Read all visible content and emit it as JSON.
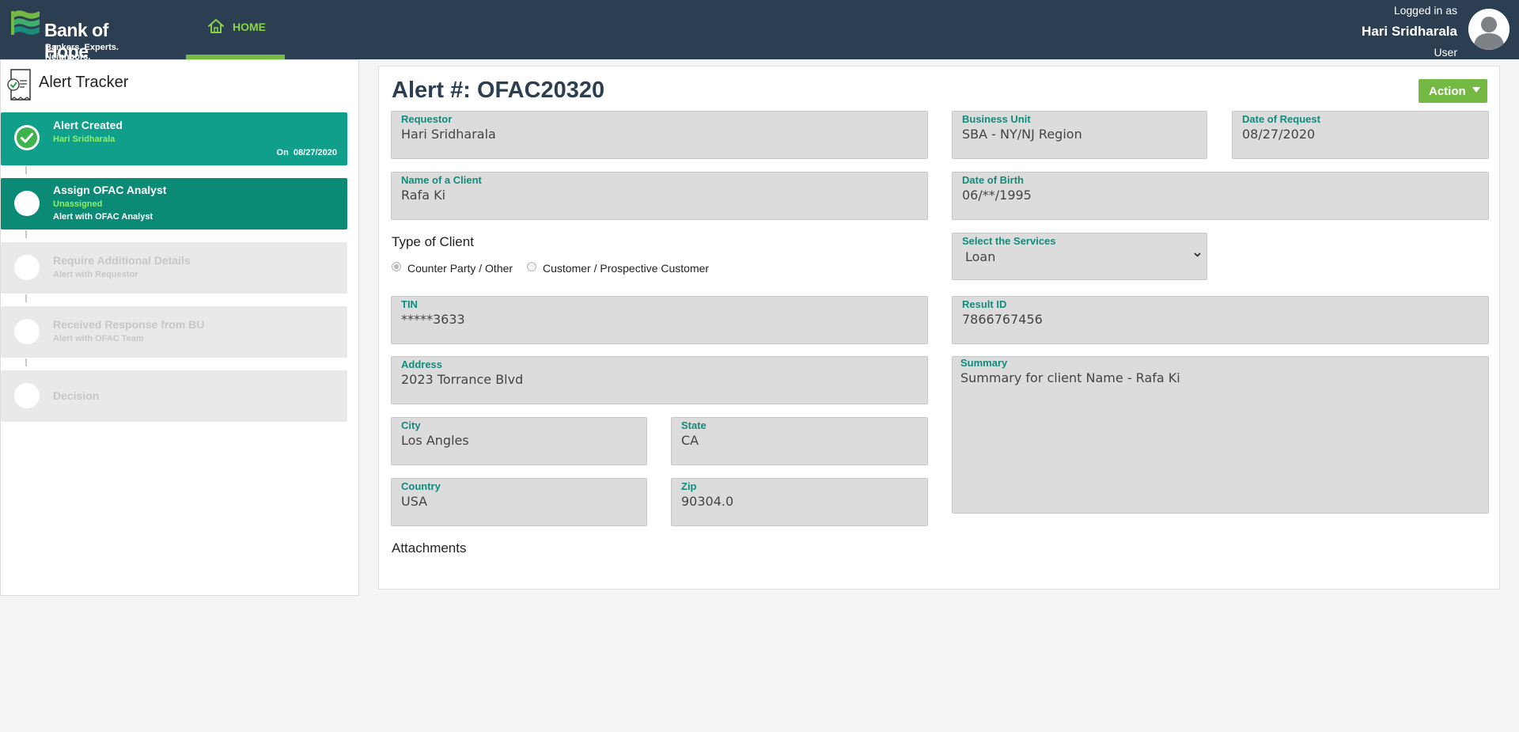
{
  "header": {
    "brand_name": "Bank of Hope",
    "brand_tagline": "Bankers. Experts. Neighbors.",
    "nav_home_label": "HOME",
    "logged_in_label": "Logged in as",
    "user_name": "Hari Sridharala",
    "user_role": "User",
    "colors": {
      "bar": "#2c3e52",
      "accent": "#73b944"
    }
  },
  "tracker": {
    "title": "Alert Tracker",
    "steps": [
      {
        "title": "Alert Created",
        "subtitle": "Hari Sridharala",
        "date_label": "On  08/27/2020",
        "status": "done"
      },
      {
        "title": "Assign OFAC Analyst",
        "subtitle": "Unassigned",
        "note": "Alert with OFAC Analyst",
        "status": "active"
      },
      {
        "title": "Require Additional Details",
        "note": "Alert with Requestor",
        "status": "pending"
      },
      {
        "title": "Received Response from BU",
        "note": "Alert with OFAC Team",
        "status": "pending"
      },
      {
        "title": "Decision",
        "status": "pending"
      }
    ]
  },
  "alert": {
    "title": "Alert #: OFAC20320",
    "action_label": "Action",
    "fields": {
      "requestor": {
        "label": "Requestor",
        "value": "Hari Sridharala"
      },
      "business_unit": {
        "label": "Business Unit",
        "value": "SBA - NY/NJ Region"
      },
      "date_of_request": {
        "label": "Date of Request",
        "value": "08/27/2020"
      },
      "client_name": {
        "label": "Name of a Client",
        "value": "Rafa Ki"
      },
      "dob": {
        "label": "Date of Birth",
        "value": "06/**/1995"
      },
      "services": {
        "label": "Select the Services",
        "value": "Loan"
      },
      "tin": {
        "label": "TIN",
        "value": "*****3633"
      },
      "result_id": {
        "label": "Result ID",
        "value": "7866767456"
      },
      "address": {
        "label": "Address",
        "value": "2023 Torrance Blvd"
      },
      "summary": {
        "label": "Summary",
        "value": "Summary for client Name - Rafa Ki"
      },
      "city": {
        "label": "City",
        "value": "Los Angles"
      },
      "state": {
        "label": "State",
        "value": "CA"
      },
      "country": {
        "label": "Country",
        "value": "USA"
      },
      "zip": {
        "label": "Zip",
        "value": "90304.0"
      }
    },
    "type_of_client": {
      "label": "Type of Client",
      "options": [
        "Counter Party / Other",
        "Customer / Prospective Customer"
      ],
      "selected": "Counter Party / Other"
    },
    "attachments_label": "Attachments"
  }
}
